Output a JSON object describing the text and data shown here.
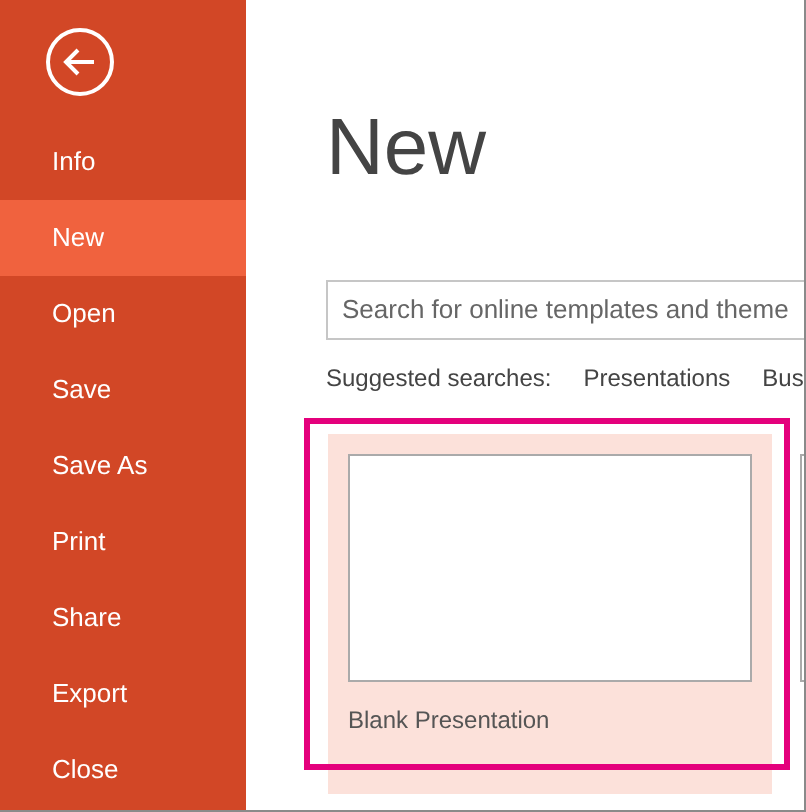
{
  "sidebar": {
    "items": [
      {
        "label": "Info",
        "selected": false
      },
      {
        "label": "New",
        "selected": true
      },
      {
        "label": "Open",
        "selected": false
      },
      {
        "label": "Save",
        "selected": false
      },
      {
        "label": "Save As",
        "selected": false
      },
      {
        "label": "Print",
        "selected": false
      },
      {
        "label": "Share",
        "selected": false
      },
      {
        "label": "Export",
        "selected": false
      },
      {
        "label": "Close",
        "selected": false
      }
    ]
  },
  "title": "New",
  "search": {
    "placeholder": "Search for online templates and theme"
  },
  "suggested": {
    "label": "Suggested searches:",
    "links": [
      "Presentations",
      "Bus"
    ]
  },
  "templates": [
    {
      "label": "Blank Presentation",
      "selected": true,
      "highlighted": true
    },
    {
      "selected": false,
      "highlighted": false
    }
  ]
}
